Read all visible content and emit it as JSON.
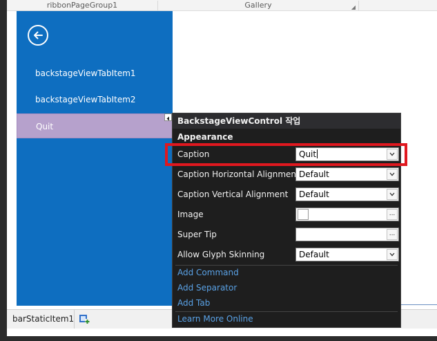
{
  "ribbon": {
    "group1_label": "ribbonPageGroup1",
    "group2_label": "Gallery"
  },
  "backstage": {
    "back_icon": "back-arrow-circle-icon",
    "items": [
      {
        "label": "backstageViewTabItem1"
      },
      {
        "label": "backstageViewTabItem2"
      },
      {
        "label": "Quit",
        "selected": true
      }
    ],
    "pane_color": "#0e6ec0",
    "selected_color": "#b6a1cc"
  },
  "status_bar": {
    "item_label": "barStaticItem1",
    "add_icon": "add-item-icon"
  },
  "tasks_panel": {
    "title": "BackstageViewControl 작업",
    "section": "Appearance",
    "properties": [
      {
        "label": "Caption",
        "value": "Quit",
        "editor": "dropdown"
      },
      {
        "label": "Caption Horizontal Alignment",
        "value": "Default",
        "editor": "dropdown"
      },
      {
        "label": "Caption Vertical Alignment",
        "value": "Default",
        "editor": "dropdown"
      },
      {
        "label": "Image",
        "value": "",
        "editor": "ellipsis"
      },
      {
        "label": "Super Tip",
        "value": "",
        "editor": "ellipsis"
      },
      {
        "label": "Allow Glyph Skinning",
        "value": "Default",
        "editor": "dropdown"
      }
    ],
    "actions": {
      "add_command": "Add Command",
      "add_separator": "Add Separator",
      "add_tab": "Add Tab",
      "learn_more": "Learn More Online"
    },
    "link_color": "#5aa2e6",
    "highlight_color": "#e0181f"
  }
}
